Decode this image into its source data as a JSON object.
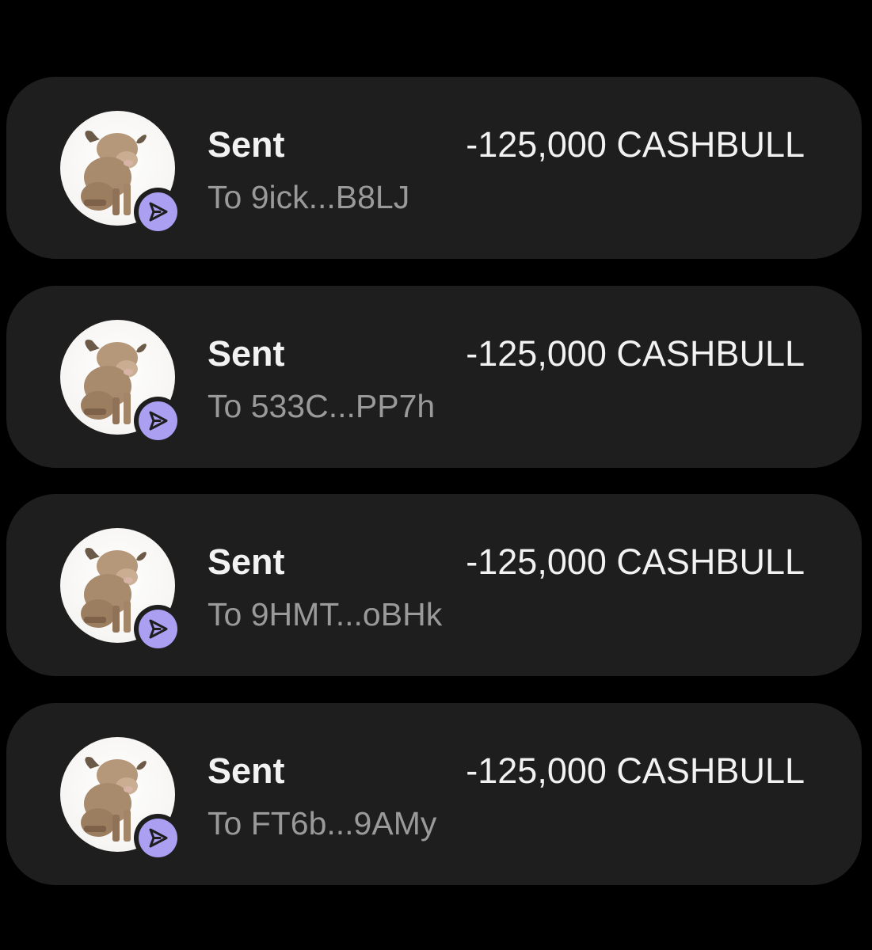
{
  "transactions": [
    {
      "type_label": "Sent",
      "amount": "-125,000 CASHBULL",
      "recipient": "To 9ick...B8LJ",
      "token_icon": "bull-token-icon",
      "status_icon": "send-arrow-icon"
    },
    {
      "type_label": "Sent",
      "amount": "-125,000 CASHBULL",
      "recipient": "To 533C...PP7h",
      "token_icon": "bull-token-icon",
      "status_icon": "send-arrow-icon"
    },
    {
      "type_label": "Sent",
      "amount": "-125,000 CASHBULL",
      "recipient": "To 9HMT...oBHk",
      "token_icon": "bull-token-icon",
      "status_icon": "send-arrow-icon"
    },
    {
      "type_label": "Sent",
      "amount": "-125,000 CASHBULL",
      "recipient": "To FT6b...9AMy",
      "token_icon": "bull-token-icon",
      "status_icon": "send-arrow-icon"
    }
  ],
  "colors": {
    "background": "#000000",
    "card": "#1e1e1f",
    "primary_text": "#f2f2f2",
    "secondary_text": "#9a9a9a",
    "badge_accent": "#ab9ff2"
  }
}
